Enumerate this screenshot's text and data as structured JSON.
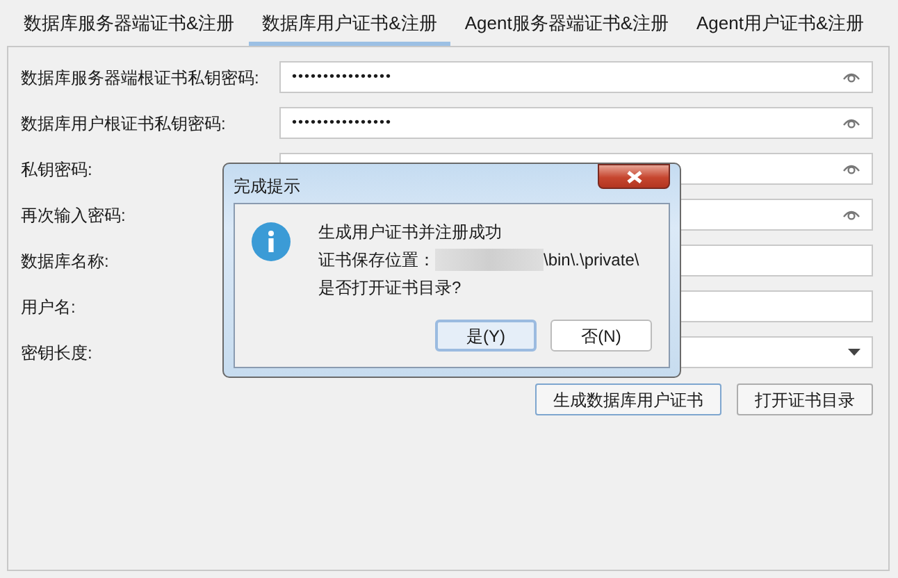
{
  "tabs": [
    {
      "label": "数据库服务器端证书&注册",
      "selected": false
    },
    {
      "label": "数据库用户证书&注册",
      "selected": true
    },
    {
      "label": "Agent服务器端证书&注册",
      "selected": false
    },
    {
      "label": "Agent用户证书&注册",
      "selected": false
    }
  ],
  "fields": [
    {
      "label": "数据库服务器端根证书私钥密码:",
      "kind": "password",
      "value": "••••••••••••••••"
    },
    {
      "label": "数据库用户根证书私钥密码:",
      "kind": "password",
      "value": "••••••••••••••••"
    },
    {
      "label": "私钥密码:",
      "kind": "password"
    },
    {
      "label": "再次输入密码:",
      "kind": "password"
    },
    {
      "label": "数据库名称:",
      "kind": "text"
    },
    {
      "label": "用户名:",
      "kind": "text"
    },
    {
      "label": "密钥长度:",
      "kind": "select"
    }
  ],
  "actions": [
    "生成数据库用户证书",
    "打开证书目录"
  ],
  "dialog": {
    "title": "完成提示",
    "lines": [
      "生成用户证书并注册成功",
      "\\bin\\.\\private\\",
      "是否打开证书目录?"
    ],
    "path_label": "证书保存位置：",
    "buttons": [
      {
        "label": "是(Y)",
        "selected": true
      },
      {
        "label": "否(N)",
        "selected": false
      }
    ]
  }
}
